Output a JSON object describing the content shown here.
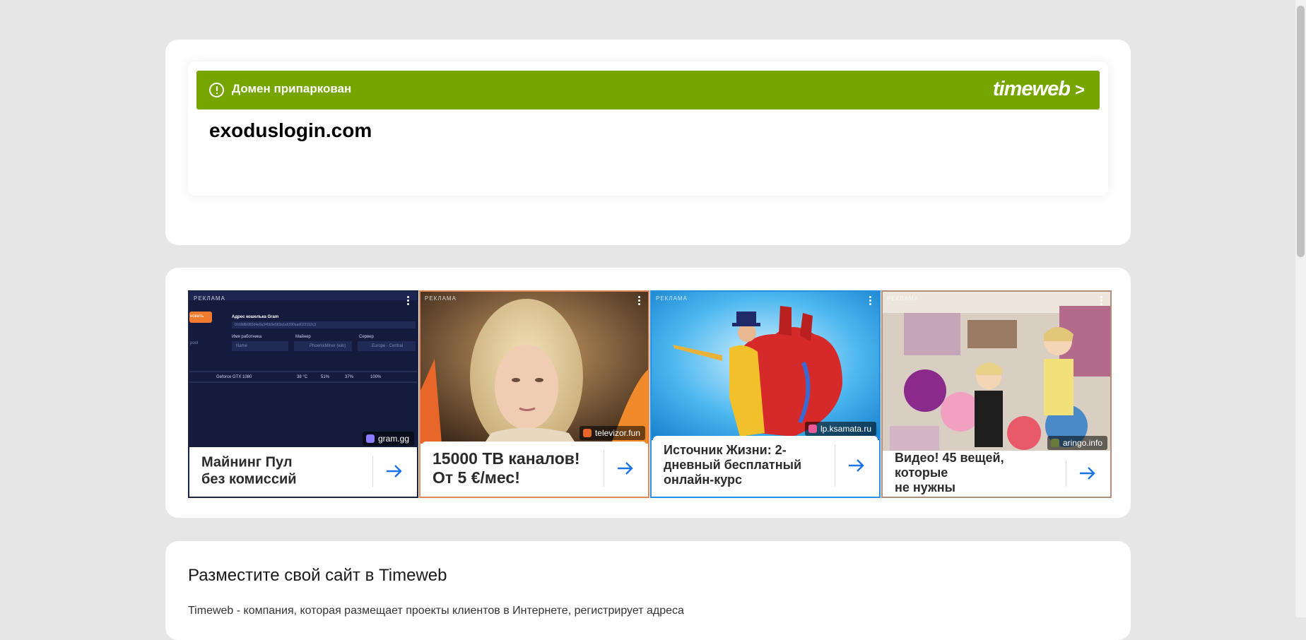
{
  "parked": {
    "status_text": "Домен припаркован",
    "brand": "timeweb",
    "domain": "exoduslogin.com",
    "bar_color": "#77a500",
    "status_icon": "exclamation-circle-icon"
  },
  "ads": {
    "label": "РЕКЛАМА",
    "items": [
      {
        "title_line1": "Майнинг Пул",
        "title_line2": "без комиссий",
        "source": "gram.gg",
        "border_color": "#1b2347",
        "image": {
          "header": "Адрес кошелька Gram",
          "wallet_placeholder": "0:b9b8b982d4e0a345b9e583a1a6390aad022152c3",
          "button": "новить",
          "side_label": "pool",
          "labels": [
            "Имя работника",
            "Майнер",
            "Сервер"
          ],
          "fields": [
            "Name",
            "PhoenixMiner (win)",
            "Europe - Central"
          ],
          "gpu_row": [
            "Geforce GTX 1080",
            "38 °C",
            "51%",
            "37%",
            "100%"
          ]
        }
      },
      {
        "title_line1": "15000 ТВ каналов!",
        "title_line2": "От 5 €/мес!",
        "source": "televizor.fun",
        "border_color": "#e0885a"
      },
      {
        "title_line1": "Источник Жизни: 2-",
        "title_line2": "дневный бесплатный",
        "title_line3": "онлайн-курс",
        "source": "lp.ksamata.ru",
        "border_color": "#2a8fe0"
      },
      {
        "title_line1": "Видео! 45 вещей, которые",
        "title_line2": "не нужны",
        "source": "aringo.info",
        "border_color": "#b48c7a"
      }
    ]
  },
  "host": {
    "title": "Разместите свой сайт в Timeweb",
    "text": "Timeweb - компания, которая размещает проекты клиентов в Интернете, регистрирует адреса"
  },
  "accent_arrow_color": "#1a73e8"
}
